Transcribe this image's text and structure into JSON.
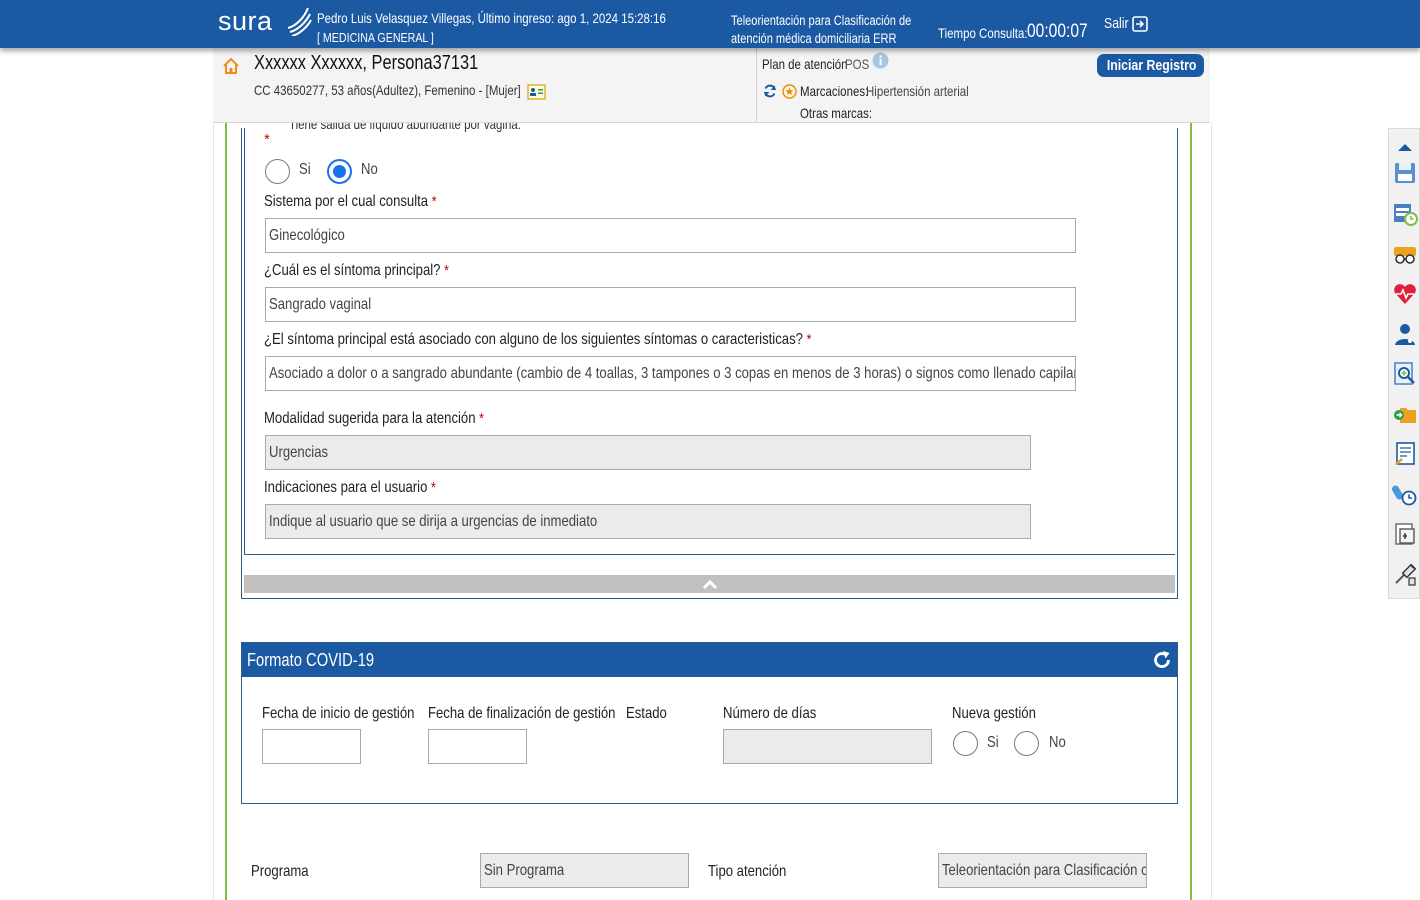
{
  "header": {
    "logo_text": "sura",
    "user_info": "Pedro Luis Velasquez Villegas, Último ingreso: ago 1, 2024 15:28:16",
    "role": "[ MEDICINA GENERAL ]",
    "service_line1": "Teleorientación para Clasificación de",
    "service_line2": "atención médica domiciliaria ERR",
    "time_label": "Tiempo Consulta:",
    "time_value": "00:00:07",
    "exit_label": "Salir"
  },
  "patient": {
    "name": "Xxxxxx Xxxxxx, Persona37131",
    "details": "CC 43650277, 53 años(Adultez), Femenino - [Mujer]",
    "plan_label": "Plan de atención",
    "plan_value": "POS",
    "marcaciones_label": "Marcaciones:",
    "marcaciones_value": "Hipertensión arterial",
    "otras_marcas_label": "Otras marcas:",
    "register_button": "Iniciar Registro"
  },
  "form": {
    "cut_question": "Tiene salida de líquido abundante por vagina:",
    "required_mark": "*",
    "radio_si": "Si",
    "radio_no": "No",
    "selected": "No",
    "fields": [
      {
        "label": "Sistema por el cual consulta",
        "value": "Ginecológico"
      },
      {
        "label": "¿Cuál es el síntoma principal?",
        "value": "Sangrado vaginal"
      },
      {
        "label": "¿El síntoma principal está asociado con alguno de los siguientes síntomas o caracteristicas?",
        "value": "Asociado a dolor o a sangrado abundante (cambio de 4 toallas, 3 tampones o 3 copas en menos de 3 horas) o signos como llenado capilar"
      },
      {
        "label": "Modalidad sugerida para la atención",
        "value": "Urgencias"
      },
      {
        "label": "Indicaciones para el usuario",
        "value": "Indique al usuario que se dirija a urgencias de inmediato"
      }
    ]
  },
  "covid": {
    "title": "Formato COVID-19",
    "start_label": "Fecha de inicio de gestión",
    "end_label": "Fecha de finalización de gestión",
    "status_label": "Estado",
    "days_label": "Número de días",
    "new_label": "Nueva gestión",
    "radio_si": "Si",
    "radio_no": "No"
  },
  "bottom": {
    "program_label": "Programa",
    "program_value": "Sin Programa",
    "type_label": "Tipo atención",
    "type_value": "Teleorientación para Clasificación c"
  },
  "toolbar_icons": [
    "scroll-up-icon",
    "save-icon",
    "schedule-icon",
    "glasses-icon",
    "heart-rate-icon",
    "doctor-icon",
    "search-document-icon",
    "folder-arrow-icon",
    "notes-icon",
    "pills-clock-icon",
    "document-print-icon",
    "syringe-icon"
  ],
  "colors": {
    "brand_blue": "#1b5aa3",
    "accent_green": "#7ac143",
    "required_red": "#cc0000",
    "radio_blue": "#1a73e8"
  }
}
